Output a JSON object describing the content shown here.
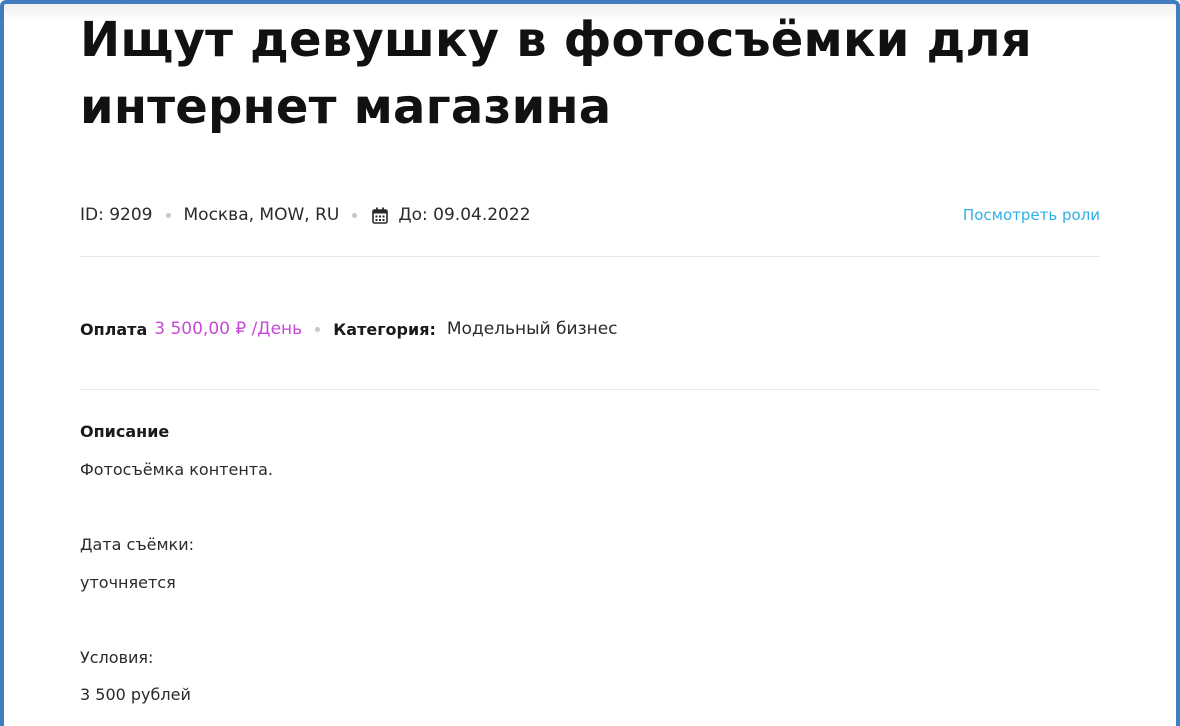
{
  "listing": {
    "title": "Ищут девушку в фотосъёмки для интернет магазина",
    "meta": {
      "id_text": "ID: 9209",
      "location": "Москва, MOW, RU",
      "deadline": "До: 09.04.2022",
      "view_roles_label": "Посмотреть роли"
    },
    "payment": {
      "label": "Оплата",
      "price": "3 500,00 ₽ /День",
      "category_label": "Категория:",
      "category_value": "Модельный бизнес"
    },
    "description": {
      "heading": "Описание",
      "lines": [
        "Фотосъёмка контента.",
        "Дата съёмки:",
        "уточняется",
        "Условия:",
        "3 500 рублей"
      ]
    }
  },
  "colors": {
    "frame_border": "#3f7dbf",
    "link": "#2fb0e6",
    "price": "#c64ad6",
    "divider": "#e6e6e6"
  },
  "icons": {
    "deadline": "calendar-icon"
  }
}
